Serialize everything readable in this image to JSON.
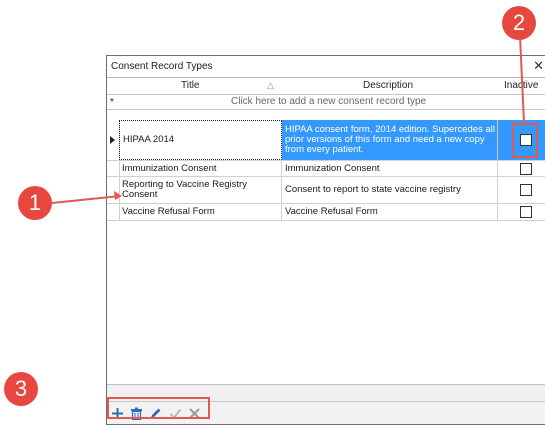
{
  "window": {
    "title": "Consent Record Types",
    "close_glyph": "✕"
  },
  "columns": {
    "title": "Title",
    "description": "Description",
    "inactive": "Inactive"
  },
  "add_row": {
    "marker": "*",
    "text": "Click here to add a new consent record type"
  },
  "rows": [
    {
      "title": "HIPAA 2014",
      "description": "HIPAA consent form, 2014 edition. Supercedes all prior versions of this form and need a new copy from every patient.",
      "inactive": false,
      "selected": true
    },
    {
      "title": "Immunization Consent",
      "description": "Immunization Consent",
      "inactive": false
    },
    {
      "title": "Reporting to Vaccine Registry Consent",
      "description": "Consent to report to state vaccine registry",
      "inactive": false
    },
    {
      "title": "Vaccine Refusal Form",
      "description": "Vaccine Refusal Form",
      "inactive": false
    }
  ],
  "toolbar": {
    "add_icon": "plus-icon",
    "delete_icon": "trash-icon",
    "edit_icon": "pencil-icon",
    "save_icon": "check-icon",
    "cancel_icon": "x-icon"
  },
  "callouts": {
    "one": "1",
    "two": "2",
    "three": "3"
  },
  "colors": {
    "selection": "#3399ff",
    "callout": "#e8473f"
  }
}
